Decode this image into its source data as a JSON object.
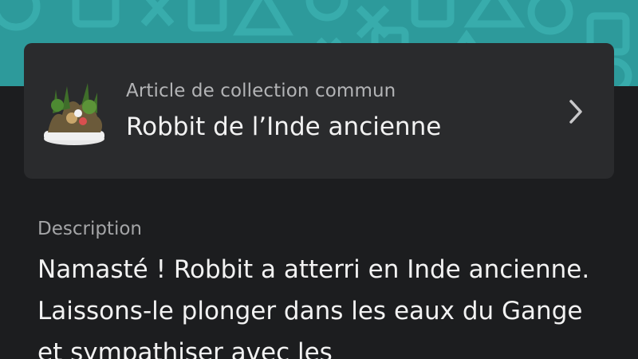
{
  "item": {
    "subtitle": "Article de collection commun",
    "title": "Robbit de l’Inde ancienne",
    "thumbnail_icon": "diorama-thumbnail",
    "chevron_icon": "chevron-right-icon"
  },
  "description": {
    "label": "Description",
    "text": "Namasté ! Robbit a atterri en Inde ancienne. Laissons-le plonger dans les eaux du Gange et sympathiser avec les"
  },
  "colors": {
    "banner": "#2d9a9b",
    "background": "#1c1d1f",
    "card": "#2a2b2d"
  }
}
